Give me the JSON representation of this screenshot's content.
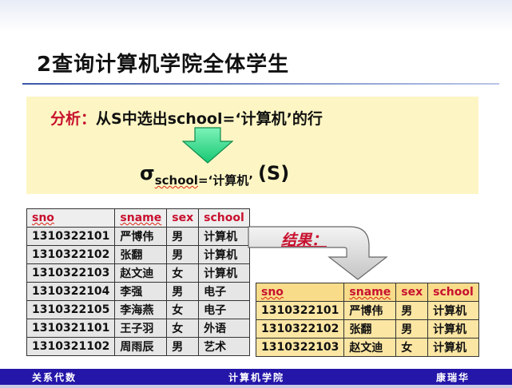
{
  "slide": {
    "title": "2查询计算机学院全体学生"
  },
  "analysis": {
    "label": "分析：",
    "text_from": "从",
    "relation": "S",
    "text_mid": "中选出",
    "condition": "school=‘计算机’",
    "text_end": "的行"
  },
  "formula": {
    "sigma": "σ",
    "subscript_name": "school",
    "subscript_value": "=‘计算机’",
    "argument": "(S)"
  },
  "result_label": "结果：",
  "source_table": {
    "headers": [
      "sno",
      "sname",
      "sex",
      "school"
    ],
    "rows": [
      [
        "1310322101",
        "严博伟",
        "男",
        "计算机"
      ],
      [
        "1310322102",
        "张翻",
        "男",
        "计算机"
      ],
      [
        "1310322103",
        "赵文迪",
        "女",
        "计算机"
      ],
      [
        "1310322104",
        "李强",
        "男",
        "电子"
      ],
      [
        "1310322105",
        "李海燕",
        "女",
        "电子"
      ],
      [
        "1310321101",
        "王子羽",
        "女",
        "外语"
      ],
      [
        "1310321102",
        "周雨辰",
        "男",
        "艺术"
      ]
    ]
  },
  "result_table": {
    "headers": [
      "sno",
      "sname",
      "sex",
      "school"
    ],
    "rows": [
      [
        "1310322101",
        "严博伟",
        "男",
        "计算机"
      ],
      [
        "1310322102",
        "张翻",
        "男",
        "计算机"
      ],
      [
        "1310322103",
        "赵文迪",
        "女",
        "计算机"
      ]
    ]
  },
  "footer": {
    "left": "关系代数",
    "center": "计算机学院",
    "right": "康瑞华"
  },
  "colors": {
    "accent_red": "#c8102e",
    "arrow_green": "#33e08a",
    "analysis_bg": "#fdf6c4",
    "footer_bg": "#2416a8"
  },
  "icons": {
    "down_arrow": "down-arrow-icon",
    "result_arrow": "curved-arrow-icon"
  }
}
